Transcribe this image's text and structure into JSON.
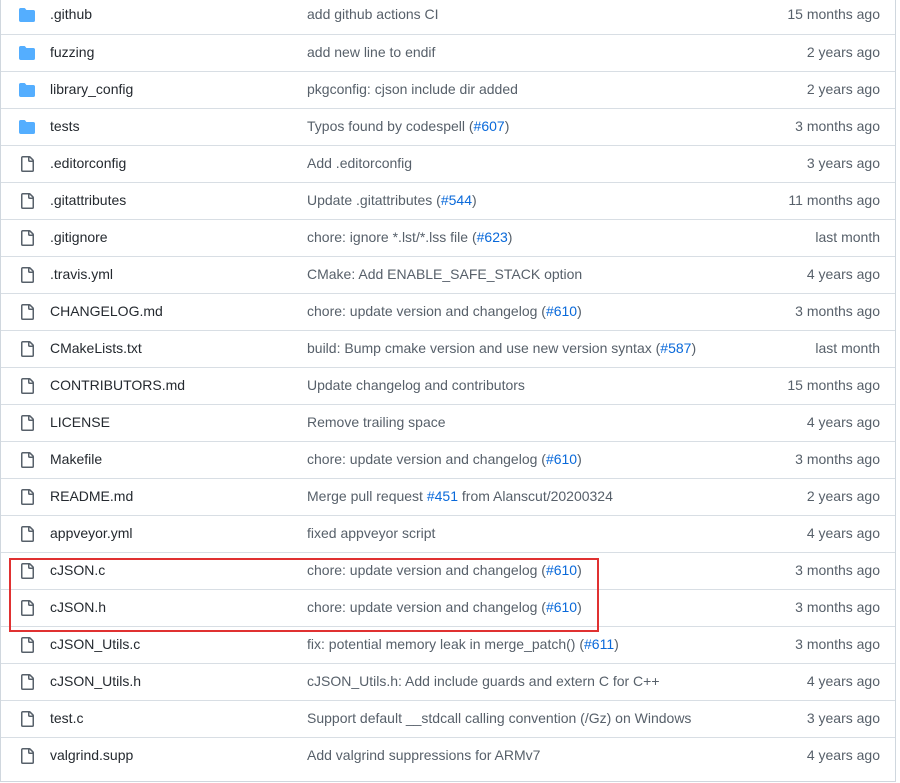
{
  "colors": {
    "folder": "#54aeff",
    "file_icon": "#57606a",
    "link": "#0969da",
    "highlight": "#e03131"
  },
  "files": [
    {
      "name": ".github",
      "icon": "folder-icon",
      "message_parts": [
        {
          "text": "add github actions CI"
        }
      ],
      "age": "15 months ago"
    },
    {
      "name": "fuzzing",
      "icon": "folder-icon",
      "message_parts": [
        {
          "text": "add new line to endif"
        }
      ],
      "age": "2 years ago"
    },
    {
      "name": "library_config",
      "icon": "folder-icon",
      "message_parts": [
        {
          "text": "pkgconfig: cjson include dir added"
        }
      ],
      "age": "2 years ago"
    },
    {
      "name": "tests",
      "icon": "folder-icon",
      "message_parts": [
        {
          "text": "Typos found by codespell ("
        },
        {
          "text": "#607",
          "link": true
        },
        {
          "text": ")"
        }
      ],
      "age": "3 months ago"
    },
    {
      "name": ".editorconfig",
      "icon": "file-icon",
      "message_parts": [
        {
          "text": "Add .editorconfig"
        }
      ],
      "age": "3 years ago"
    },
    {
      "name": ".gitattributes",
      "icon": "file-icon",
      "message_parts": [
        {
          "text": "Update .gitattributes ("
        },
        {
          "text": "#544",
          "link": true
        },
        {
          "text": ")"
        }
      ],
      "age": "11 months ago"
    },
    {
      "name": ".gitignore",
      "icon": "file-icon",
      "message_parts": [
        {
          "text": "chore: ignore *.lst/*.lss file ("
        },
        {
          "text": "#623",
          "link": true
        },
        {
          "text": ")"
        }
      ],
      "age": "last month"
    },
    {
      "name": ".travis.yml",
      "icon": "file-icon",
      "message_parts": [
        {
          "text": "CMake: Add ENABLE_SAFE_STACK option"
        }
      ],
      "age": "4 years ago"
    },
    {
      "name": "CHANGELOG.md",
      "icon": "file-icon",
      "message_parts": [
        {
          "text": "chore: update version and changelog ("
        },
        {
          "text": "#610",
          "link": true
        },
        {
          "text": ")"
        }
      ],
      "age": "3 months ago"
    },
    {
      "name": "CMakeLists.txt",
      "icon": "file-icon",
      "message_parts": [
        {
          "text": "build: Bump cmake version and use new version syntax ("
        },
        {
          "text": "#587",
          "link": true
        },
        {
          "text": ")"
        }
      ],
      "age": "last month"
    },
    {
      "name": "CONTRIBUTORS.md",
      "icon": "file-icon",
      "message_parts": [
        {
          "text": "Update changelog and contributors"
        }
      ],
      "age": "15 months ago"
    },
    {
      "name": "LICENSE",
      "icon": "file-icon",
      "message_parts": [
        {
          "text": "Remove trailing space"
        }
      ],
      "age": "4 years ago"
    },
    {
      "name": "Makefile",
      "icon": "file-icon",
      "message_parts": [
        {
          "text": "chore: update version and changelog ("
        },
        {
          "text": "#610",
          "link": true
        },
        {
          "text": ")"
        }
      ],
      "age": "3 months ago"
    },
    {
      "name": "README.md",
      "icon": "file-icon",
      "message_parts": [
        {
          "text": "Merge pull request "
        },
        {
          "text": "#451",
          "link": true
        },
        {
          "text": " from Alanscut/20200324"
        }
      ],
      "age": "2 years ago"
    },
    {
      "name": "appveyor.yml",
      "icon": "file-icon",
      "message_parts": [
        {
          "text": "fixed appveyor script"
        }
      ],
      "age": "4 years ago"
    },
    {
      "name": "cJSON.c",
      "icon": "file-icon",
      "message_parts": [
        {
          "text": "chore: update version and changelog ("
        },
        {
          "text": "#610",
          "link": true
        },
        {
          "text": ")"
        }
      ],
      "age": "3 months ago"
    },
    {
      "name": "cJSON.h",
      "icon": "file-icon",
      "message_parts": [
        {
          "text": "chore: update version and changelog ("
        },
        {
          "text": "#610",
          "link": true
        },
        {
          "text": ")"
        }
      ],
      "age": "3 months ago"
    },
    {
      "name": "cJSON_Utils.c",
      "icon": "file-icon",
      "message_parts": [
        {
          "text": "fix: potential memory leak in merge_patch() ("
        },
        {
          "text": "#611",
          "link": true
        },
        {
          "text": ")"
        }
      ],
      "age": "3 months ago"
    },
    {
      "name": "cJSON_Utils.h",
      "icon": "file-icon",
      "message_parts": [
        {
          "text": "cJSON_Utils.h: Add include guards and extern C for C++"
        }
      ],
      "age": "4 years ago"
    },
    {
      "name": "test.c",
      "icon": "file-icon",
      "message_parts": [
        {
          "text": "Support default __stdcall calling convention (/Gz) on Windows"
        }
      ],
      "age": "3 years ago"
    },
    {
      "name": "valgrind.supp",
      "icon": "file-icon",
      "message_parts": [
        {
          "text": "Add valgrind suppressions for ARMv7"
        }
      ],
      "age": "4 years ago"
    }
  ]
}
